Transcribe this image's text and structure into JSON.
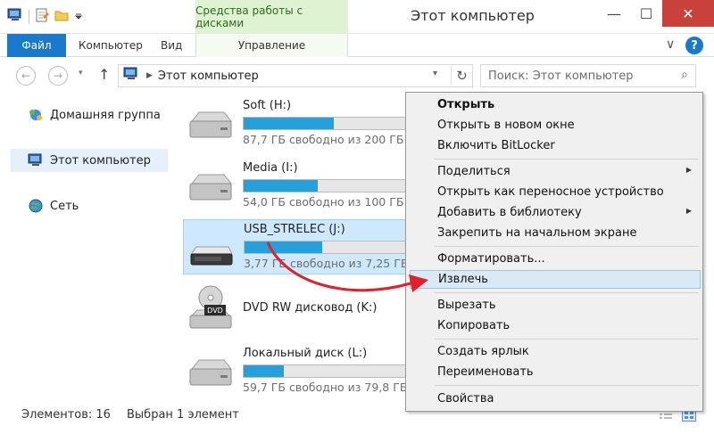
{
  "window": {
    "title": "Этот компьютер",
    "context_tab_title": "Средства работы с дисками",
    "min_glyph": "—",
    "max_glyph": "☐",
    "close_glyph": "✕"
  },
  "ribbon": {
    "tabs": [
      {
        "label": "Файл"
      },
      {
        "label": "Компьютер"
      },
      {
        "label": "Вид"
      },
      {
        "label": "Управление"
      }
    ],
    "chevron": "∨",
    "help": "?"
  },
  "nav": {
    "back": "←",
    "forward": "→",
    "recent": "▾",
    "up": "↑",
    "crumb_separator": "▶",
    "address": "Этот компьютер",
    "address_dropdown": "▾",
    "refresh": "↻",
    "search_placeholder": "Поиск: Этот компьютер",
    "search_icon": "⌕"
  },
  "sidebar": {
    "items": [
      {
        "label": "Домашняя группа",
        "icon": "homegroup-icon"
      },
      {
        "label": "Этот компьютер",
        "icon": "computer-icon"
      },
      {
        "label": "Сеть",
        "icon": "network-icon"
      }
    ]
  },
  "drives": [
    {
      "name": "Soft (H:)",
      "free": "87,7 ГБ свободно из 200 ГБ",
      "used_fraction": 0.56,
      "icon": "hdd-icon"
    },
    {
      "name": "Media (I:)",
      "free": "54,0 ГБ свободно из 100 ГБ",
      "used_fraction": 0.46,
      "icon": "hdd-icon"
    },
    {
      "name": "USB_STRELEC (J:)",
      "free": "3,77 ГБ свободно из 7,25 ГБ",
      "used_fraction": 0.48,
      "icon": "usb-drive-icon"
    },
    {
      "name": "DVD RW дисковод (K:)",
      "icon": "dvd-drive-icon",
      "badge": "DVD"
    },
    {
      "name": "Локальный диск (L:)",
      "free": "59,7 ГБ свободно из 79,8 ГБ",
      "used_fraction": 0.25,
      "icon": "hdd-icon"
    }
  ],
  "context_menu": {
    "items": [
      {
        "label": "Открыть"
      },
      {
        "label": "Открыть в новом окне"
      },
      {
        "label": "Включить BitLocker"
      },
      {
        "label": "Поделиться"
      },
      {
        "label": "Открыть как переносное устройство"
      },
      {
        "label": "Добавить в библиотеку"
      },
      {
        "label": "Закрепить на начальном экране"
      },
      {
        "label": "Форматировать..."
      },
      {
        "label": "Извлечь"
      },
      {
        "label": "Вырезать"
      },
      {
        "label": "Копировать"
      },
      {
        "label": "Создать ярлык"
      },
      {
        "label": "Переименовать"
      },
      {
        "label": "Свойства"
      }
    ],
    "submenu_arrow": "▶"
  },
  "status": {
    "count": "Элементов: 16",
    "selected": "Выбран 1 элемент"
  },
  "colors": {
    "accent": "#1979ca",
    "bar_fill": "#26a0da",
    "selection": "#cde8ff",
    "annotation": "#e0202a"
  }
}
